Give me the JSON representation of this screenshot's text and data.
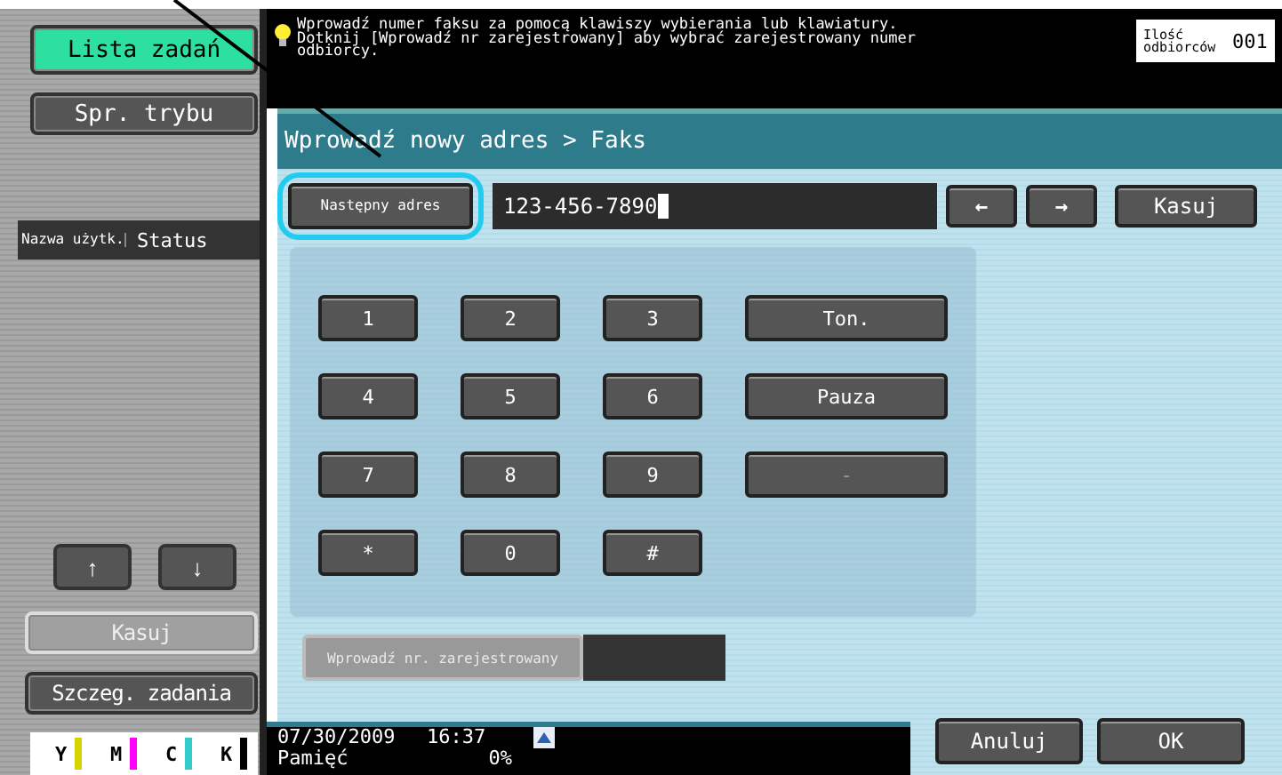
{
  "sidebar": {
    "job_list_button": {
      "label": "Lista zadań",
      "selected": true
    },
    "mode_check_button": {
      "label": "Spr. trybu"
    },
    "job_table": {
      "columns": [
        "Nazwa użytk.",
        "Status"
      ]
    },
    "scroll_buttons": [
      {
        "label": "↑"
      },
      {
        "label": "↓"
      }
    ],
    "delete_button": {
      "label": "Kasuj",
      "disabled": true
    },
    "details_button": {
      "label": "Szczeg. zadania"
    },
    "toner": [
      {
        "label": "Y",
        "color": "#d4d400"
      },
      {
        "label": "M",
        "color": "#ff00ff"
      },
      {
        "label": "C",
        "color": "#33cccc"
      },
      {
        "label": "K",
        "color": "#000000"
      }
    ]
  },
  "message": "Wprowadź numer faksu za pomocą klawiszy wybierania lub klawiatury. Dotknij [Wprowadź nr zarejestrowany] aby wybrać zarejestrowany numer odbiorcy.",
  "recipients": {
    "label": "Ilość odbiorców",
    "count": "001"
  },
  "breadcrumb": "Wprowadź nowy adres > Faks",
  "next_address_button": {
    "label": "Następny adres",
    "highlighted": true
  },
  "fax_number_field": {
    "value": "123-456-7890"
  },
  "cursor_buttons": [
    {
      "label": "←"
    },
    {
      "label": "→"
    }
  ],
  "clear_button": {
    "label": "Kasuj"
  },
  "keypad": [
    {
      "label": "1",
      "disabled": false
    },
    {
      "label": "2",
      "disabled": false
    },
    {
      "label": "3",
      "disabled": false
    },
    {
      "label": "Ton.",
      "disabled": false
    },
    {
      "label": "4",
      "disabled": false
    },
    {
      "label": "5",
      "disabled": false
    },
    {
      "label": "6",
      "disabled": false
    },
    {
      "label": "Pauza",
      "disabled": false
    },
    {
      "label": "7",
      "disabled": false
    },
    {
      "label": "8",
      "disabled": false
    },
    {
      "label": "9",
      "disabled": false
    },
    {
      "label": "-",
      "disabled": true
    },
    {
      "label": "*",
      "disabled": false
    },
    {
      "label": "0",
      "disabled": false
    },
    {
      "label": "#",
      "disabled": false
    }
  ],
  "registered_button": {
    "label": "Wprowadź nr. zarejestrowany",
    "disabled": true
  },
  "status_bar": {
    "date": "07/30/2009",
    "time": "16:37",
    "memory_label": "Pamięć",
    "memory_value": "0%"
  },
  "buttons": [
    "Anuluj",
    "OK"
  ]
}
